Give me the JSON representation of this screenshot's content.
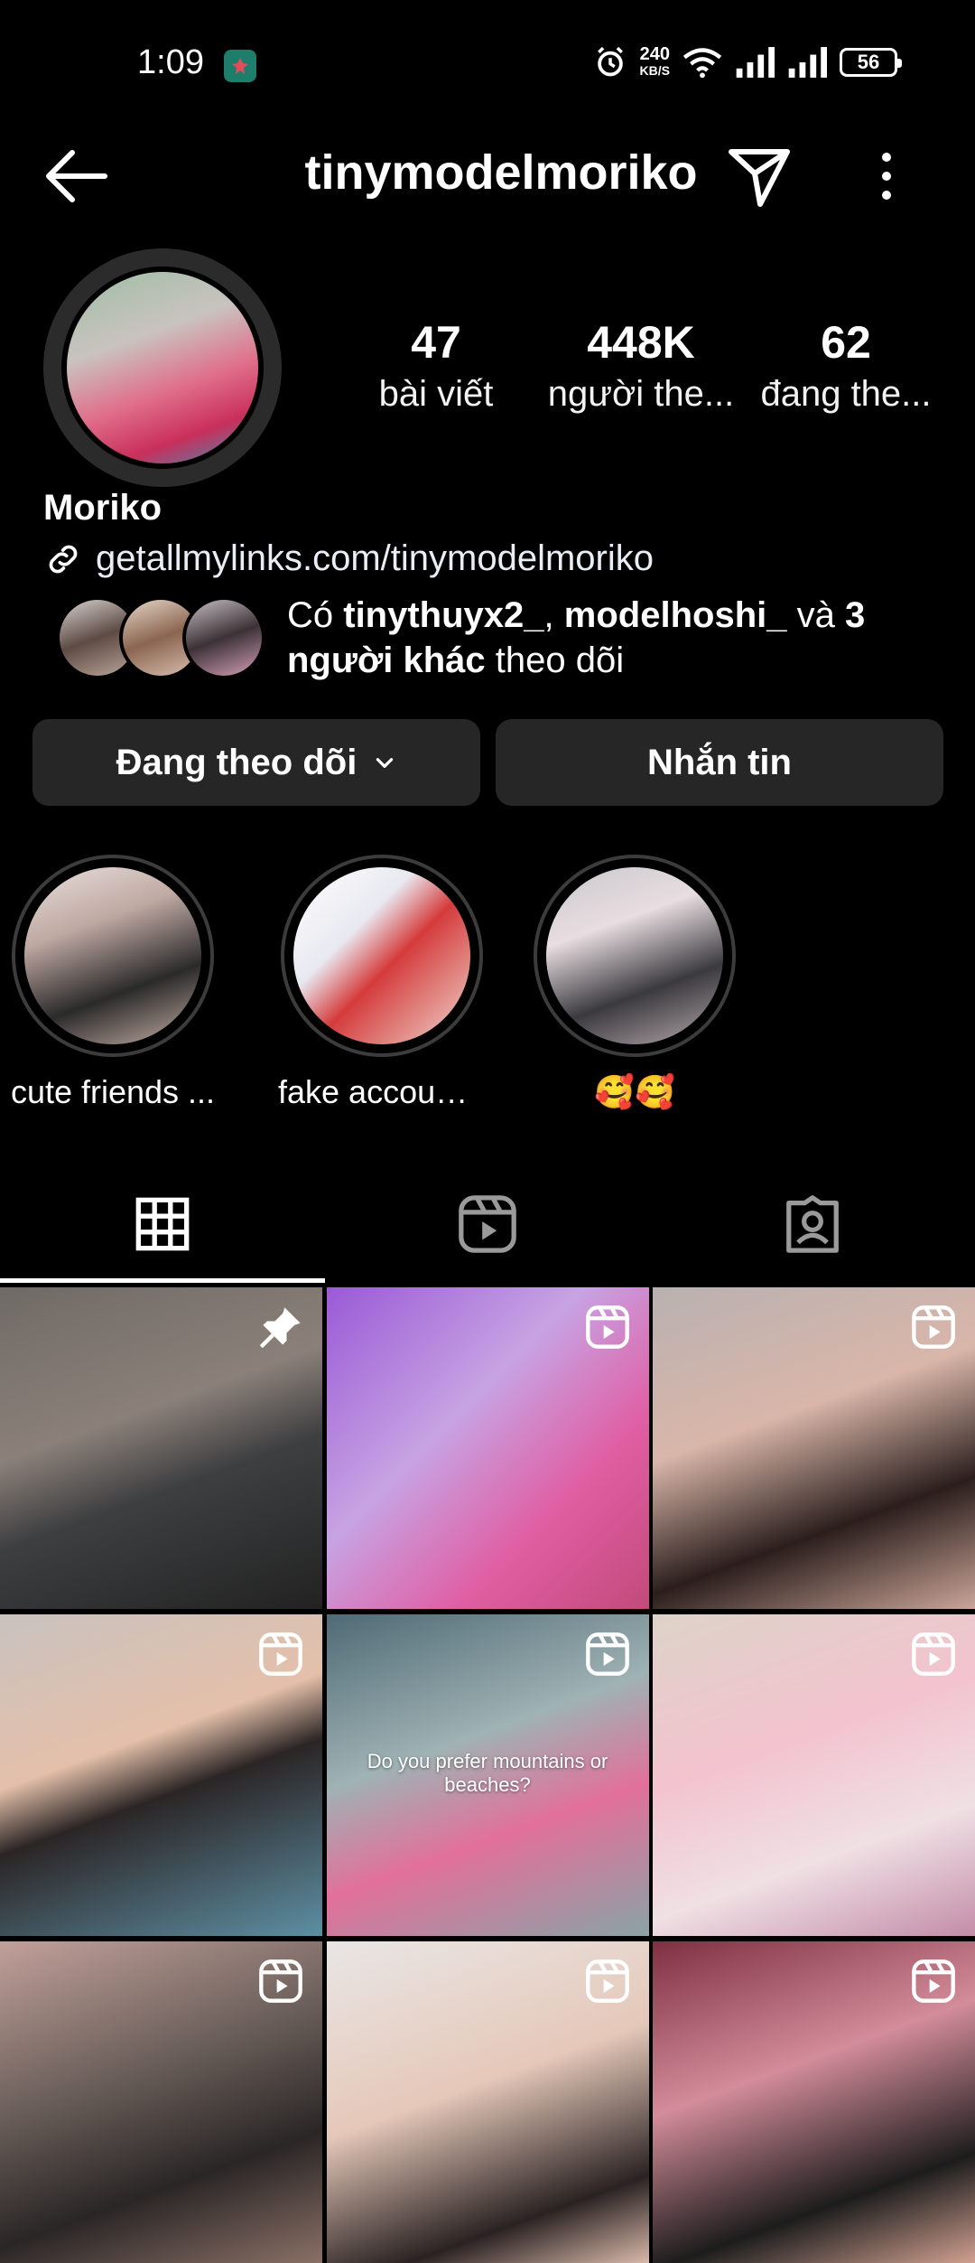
{
  "status_bar": {
    "time": "1:09",
    "speed_value": "240",
    "speed_unit": "KB/S",
    "battery": "56"
  },
  "header": {
    "username": "tinymodelmoriko",
    "icons": [
      "back-arrow-icon",
      "send-icon",
      "more-vertical-icon"
    ]
  },
  "profile": {
    "display_name": "Moriko",
    "link": "getallmylinks.com/tinymodelmoriko",
    "stats": [
      {
        "value": "47",
        "label": "bài viết"
      },
      {
        "value": "448K",
        "label": "người the..."
      },
      {
        "value": "62",
        "label": "đang the..."
      }
    ],
    "mutual": {
      "prefix": "Có ",
      "user1": "tinythuyx2_",
      "sep": ", ",
      "user2": "modelhoshi_",
      "and": " và ",
      "others": "3 người khác",
      "suffix": " theo dõi"
    }
  },
  "buttons": {
    "following_label": "Đang theo dõi",
    "message_label": "Nhắn tin"
  },
  "highlights": [
    {
      "label": "cute friends ..."
    },
    {
      "label": "fake accounts ..."
    },
    {
      "label": "🥰🥰"
    }
  ],
  "tabs": [
    "grid-icon",
    "reels-icon",
    "tagged-icon"
  ],
  "grid_posts": [
    {
      "type": "pinned"
    },
    {
      "type": "reel"
    },
    {
      "type": "reel"
    },
    {
      "type": "reel"
    },
    {
      "type": "reel",
      "caption": "Do you prefer mountains or beaches?"
    },
    {
      "type": "reel"
    },
    {
      "type": "reel"
    },
    {
      "type": "reel"
    },
    {
      "type": "reel"
    }
  ],
  "colors": {
    "background": "#000000",
    "button": "#262626",
    "text": "#ffffff"
  }
}
